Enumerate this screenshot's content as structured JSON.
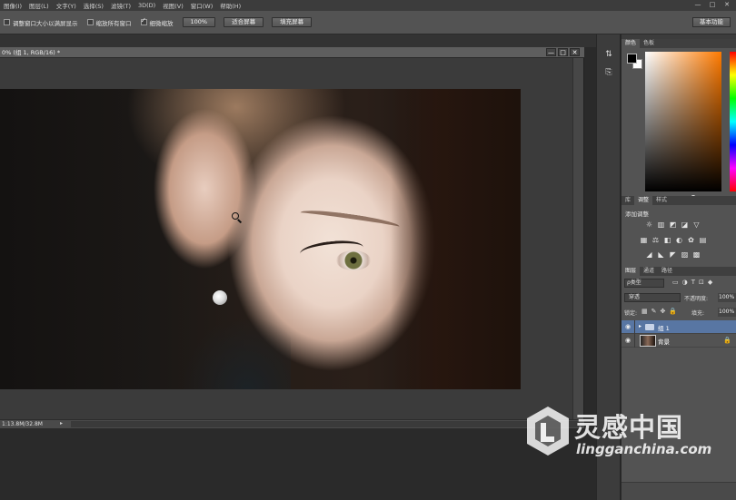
{
  "menu": [
    "图像(I)",
    "图层(L)",
    "文字(Y)",
    "选择(S)",
    "滤镜(T)",
    "3D(D)",
    "视图(V)",
    "窗口(W)",
    "帮助(H)"
  ],
  "window_controls": {
    "minimize": "—",
    "maximize": "□",
    "close": "✕"
  },
  "options_bar": {
    "resize_windows_label": "调整窗口大小以满屏显示",
    "zoom_all_label": "缩放所有窗口",
    "scrubby_zoom_label": "细微缩放",
    "zoom_100_button": "100%",
    "fit_screen_button": "适合屏幕",
    "fill_screen_button": "填充屏幕",
    "workspace_button": "基本功能"
  },
  "document": {
    "tab_title": "0% (组 1, RGB/16) *",
    "status_text": "1:13.8M/32.8M",
    "status_arrow": "▸",
    "controls": {
      "minimize": "—",
      "maximize": "□",
      "close": "✕"
    }
  },
  "tool_icons": [
    "swap-tool-icon",
    "history-tool-icon"
  ],
  "panels": {
    "color_tabs": [
      "颜色",
      "色板"
    ],
    "adjust_tabs": [
      "库",
      "调整",
      "样式"
    ],
    "adjust_title": "添加调整",
    "adjust_row1": [
      "☼",
      "▥",
      "◩",
      "◪",
      "▽"
    ],
    "adjust_row2": [
      "▦",
      "⚖",
      "◧",
      "◐",
      "✿",
      "▤"
    ],
    "adjust_row3": [
      "◢",
      "◣",
      "◤",
      "▨",
      "▩"
    ],
    "layers_tabs": [
      "图层",
      "通道",
      "路径"
    ],
    "layer_kind": "ρ类型",
    "filter_icons": [
      "▭",
      "◑",
      "T",
      "⊡",
      "◆"
    ],
    "blend_mode": "穿透",
    "opacity_label": "不透明度:",
    "opacity_value": "100%",
    "lock_label": "锁定:",
    "lock_icons": [
      "▦",
      "✎",
      "✥",
      "🔒"
    ],
    "fill_label": "填充:",
    "fill_value": "100%",
    "layers": [
      {
        "name": "组 1",
        "type": "group",
        "visible": true,
        "selected": true
      },
      {
        "name": "背景",
        "type": "image",
        "visible": true,
        "locked": true
      }
    ]
  },
  "colors": {
    "foreground": "#000000",
    "background": "#ffffff",
    "selected_layer": "#5876a3",
    "panel_bg": "#535353"
  },
  "watermark": {
    "name": "灵感中国",
    "url": "lingganchina.com"
  }
}
